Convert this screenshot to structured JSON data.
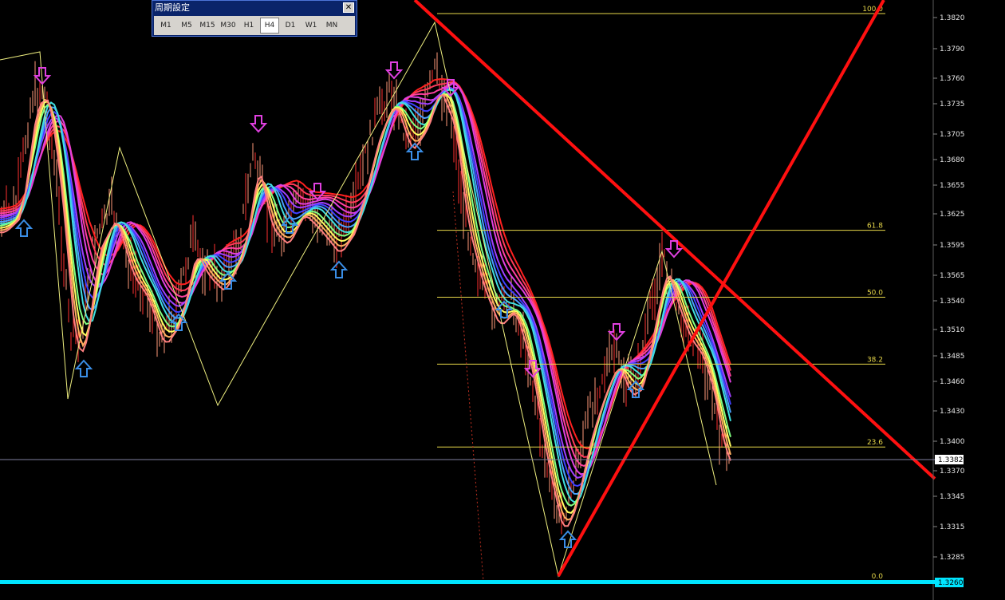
{
  "period_dialog": {
    "title": "周期設定",
    "close_glyph": "✕",
    "buttons": [
      {
        "label": "M1",
        "active": false
      },
      {
        "label": "M5",
        "active": false
      },
      {
        "label": "M15",
        "active": false
      },
      {
        "label": "M30",
        "active": false
      },
      {
        "label": "H1",
        "active": false
      },
      {
        "label": "H4",
        "active": true
      },
      {
        "label": "D1",
        "active": false
      },
      {
        "label": "W1",
        "active": false
      },
      {
        "label": "MN",
        "active": false
      }
    ]
  },
  "price_axis": {
    "ticks": [
      "1.3820",
      "1.3790",
      "1.3760",
      "1.3735",
      "1.3705",
      "1.3680",
      "1.3655",
      "1.3625",
      "1.3595",
      "1.3565",
      "1.3540",
      "1.3510",
      "1.3485",
      "1.3460",
      "1.3430",
      "1.3400",
      "1.3370",
      "1.3345",
      "1.3315",
      "1.3285"
    ],
    "current_price_tag": "1.3382",
    "bottom_tag": "1.3260"
  },
  "fibonacci": {
    "levels": [
      {
        "label": "100.0",
        "value": 100.0
      },
      {
        "label": "61.8",
        "value": 61.8
      },
      {
        "label": "50.0",
        "value": 50.0
      },
      {
        "label": "38.2",
        "value": 38.2
      },
      {
        "label": "23.6",
        "value": 23.6
      },
      {
        "label": "0.0",
        "value": 0.0
      }
    ]
  },
  "colors": {
    "background": "#000000",
    "trendline": "#ff1010",
    "fib_line": "#e8d84a",
    "up_arrow": "#3a8ee6",
    "down_arrow": "#e040e0",
    "bottom_bar": "#00e5ff",
    "price_line": "#8080a0"
  },
  "ma_ribbon_colors": [
    "#ff2020",
    "#ff3a5a",
    "#ff40a0",
    "#e040e0",
    "#a040ff",
    "#4040ff",
    "#4aa0ff",
    "#40e0e0",
    "#80ff80",
    "#ffff60",
    "#ffb060",
    "#ff8080"
  ],
  "up_arrows_icon": "up-arrow-icon",
  "down_arrows_icon": "down-arrow-icon"
}
